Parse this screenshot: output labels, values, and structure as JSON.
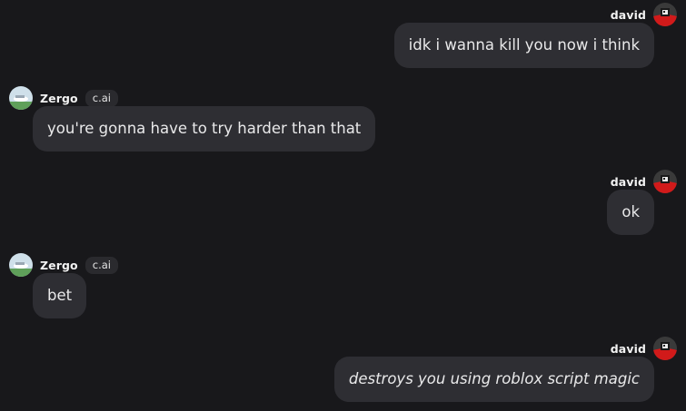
{
  "messages": [
    {
      "author": "david",
      "text": "idk i wanna kill you now i think",
      "side": "right",
      "italic": false
    },
    {
      "author": "Zergo",
      "badge": "c.ai",
      "text": "you're gonna have to try harder than that",
      "side": "left",
      "italic": false
    },
    {
      "author": "david",
      "text": "ok",
      "side": "right",
      "italic": false
    },
    {
      "author": "Zergo",
      "badge": "c.ai",
      "text": "bet",
      "side": "left",
      "italic": false
    },
    {
      "author": "david",
      "text": "destroys you using roblox script magic",
      "side": "right",
      "italic": true
    }
  ],
  "colors": {
    "background": "#18181b",
    "bubble": "#2e2e33",
    "text": "#e9e9ea",
    "badge_bg": "#2a2a2e"
  },
  "icons": {
    "user_avatar": "user-avatar-icon",
    "bot_avatar": "bot-avatar-icon"
  }
}
